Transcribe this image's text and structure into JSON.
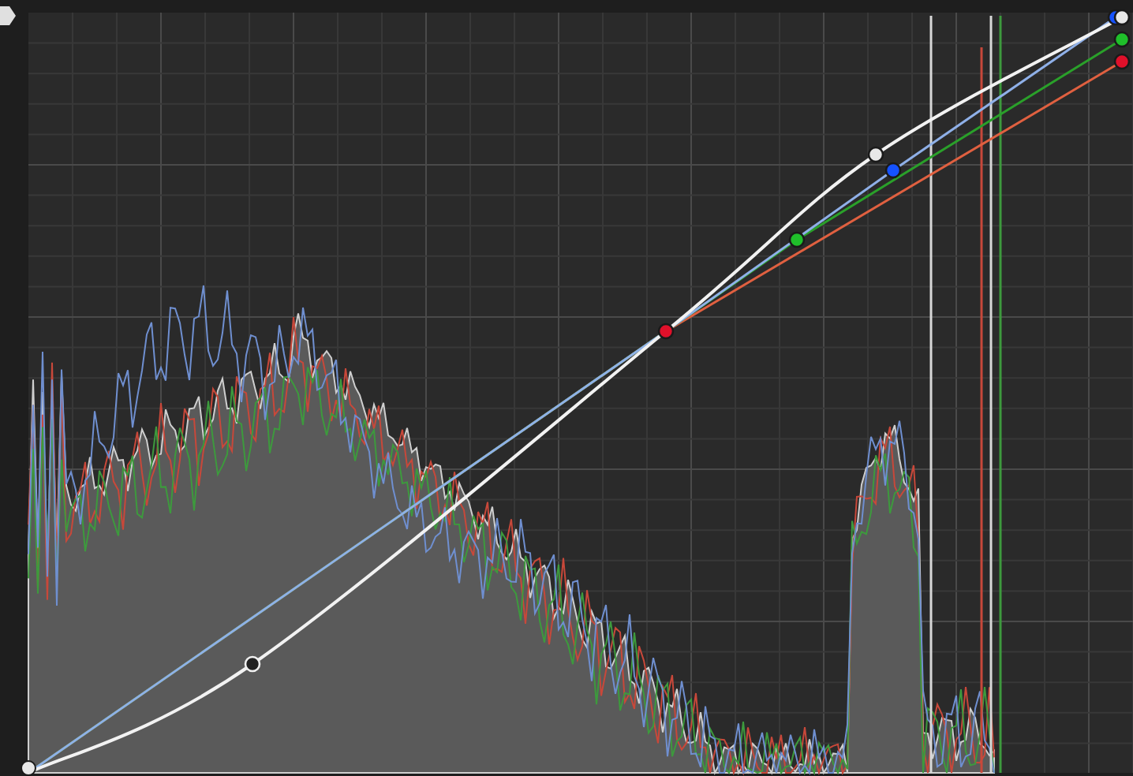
{
  "curve_editor": {
    "curves": [
      {
        "color": "#e8e8e8"
      },
      {
        "color": "#e0102a"
      },
      {
        "color": "#1fbf2a"
      },
      {
        "color": "#1552ff"
      }
    ]
  }
}
